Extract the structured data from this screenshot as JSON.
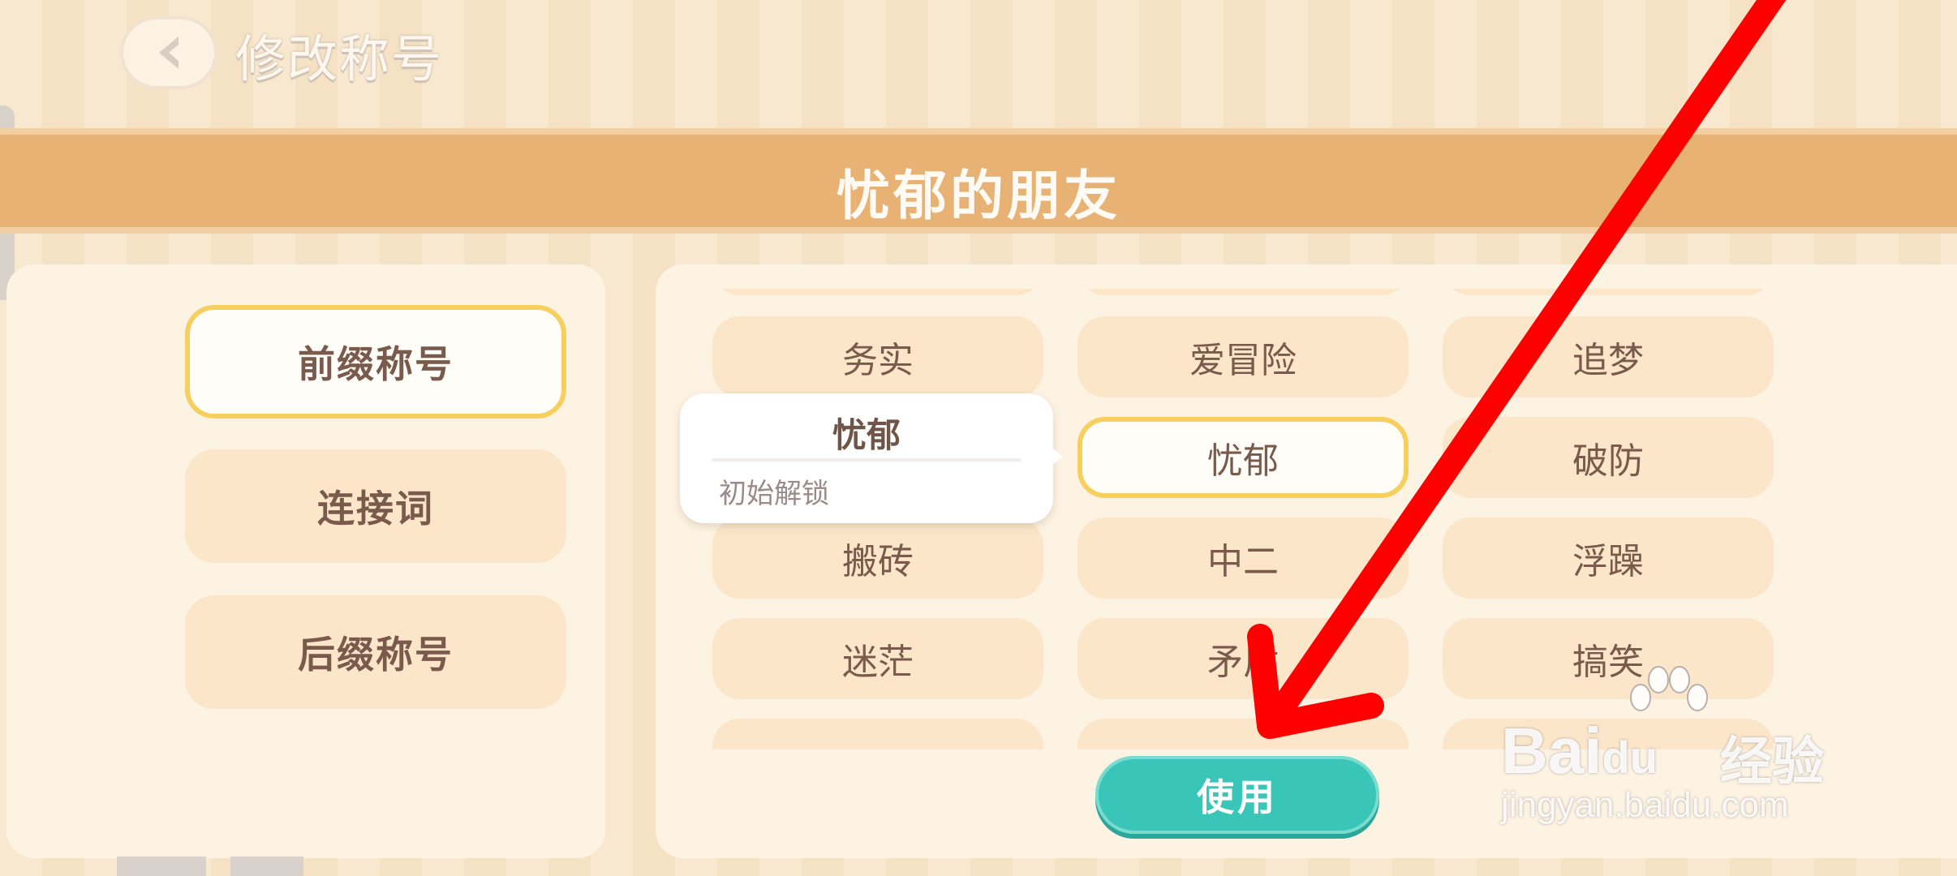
{
  "header": {
    "title": "修改称号",
    "back_icon": "chevron-left-icon"
  },
  "banner": {
    "title": "忧郁的朋友"
  },
  "categories": [
    {
      "label": "前缀称号",
      "active": true
    },
    {
      "label": "连接词",
      "active": false
    },
    {
      "label": "后缀称号",
      "active": false
    }
  ],
  "titles": {
    "rows": [
      [
        "务实",
        "爱冒险",
        "追梦"
      ],
      [
        "",
        "忧郁",
        "破防"
      ],
      [
        "搬砖",
        "中二",
        "浮躁"
      ],
      [
        "迷茫",
        "矛盾",
        "搞笑"
      ]
    ],
    "selected": "忧郁"
  },
  "popup": {
    "title": "忧郁",
    "description": "初始解锁"
  },
  "actions": {
    "use_label": "使用"
  },
  "watermark": {
    "logo_prefix": "Bai",
    "logo_suffix": "du",
    "brand": "经验",
    "url": "jingyan.baidu.com"
  },
  "colors": {
    "banner": "#e8b274",
    "accent_button": "#39c6b8",
    "selected_border": "#f6cf5e",
    "annotation_arrow": "#ff0000"
  }
}
